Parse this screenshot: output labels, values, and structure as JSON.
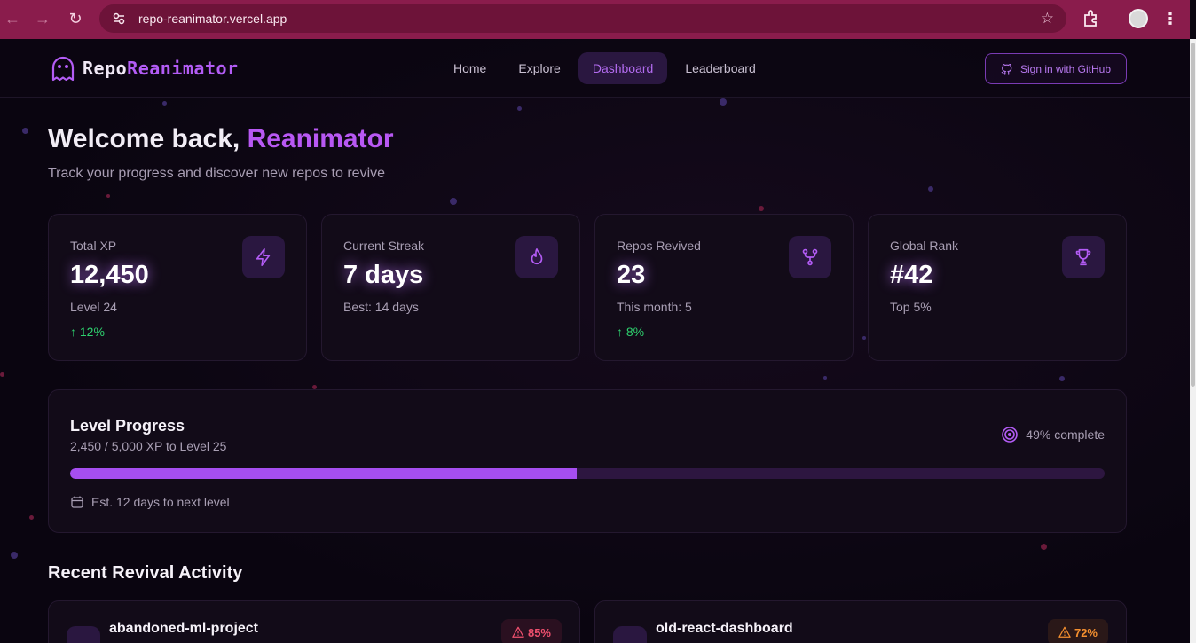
{
  "browser": {
    "url": "repo-reanimator.vercel.app"
  },
  "nav": {
    "brand_part1": "Repo",
    "brand_part2": "Reanimator",
    "links": [
      {
        "label": "Home"
      },
      {
        "label": "Explore"
      },
      {
        "label": "Dashboard"
      },
      {
        "label": "Leaderboard"
      }
    ],
    "signin_label": "Sign in with GitHub"
  },
  "hero": {
    "greeting": "Welcome back,",
    "username": "Reanimator",
    "subtitle": "Track your progress and discover new repos to revive"
  },
  "stats": [
    {
      "label": "Total XP",
      "value": "12,450",
      "sub": "Level 24",
      "trend": "↑ 12%",
      "icon": "lightning-icon"
    },
    {
      "label": "Current Streak",
      "value": "7 days",
      "sub": "Best: 14 days",
      "trend": "",
      "icon": "flame-icon"
    },
    {
      "label": "Repos Revived",
      "value": "23",
      "sub": "This month: 5",
      "trend": "↑ 8%",
      "icon": "git-fork-icon"
    },
    {
      "label": "Global Rank",
      "value": "#42",
      "sub": "Top 5%",
      "trend": "",
      "icon": "trophy-icon"
    }
  ],
  "level_progress": {
    "title": "Level Progress",
    "xp_text": "2,450 / 5,000 XP to Level 25",
    "complete_text": "49% complete",
    "fill_fraction": 0.49,
    "estimate": "Est. 12 days to next level"
  },
  "recent": {
    "title": "Recent Revival Activity",
    "items": [
      {
        "name": "abandoned-ml-project",
        "percent": "85%",
        "status_color": "#f0506e"
      },
      {
        "name": "old-react-dashboard",
        "percent": "72%",
        "status_color": "#f5902f"
      }
    ]
  },
  "colors": {
    "accent": "#b858f3",
    "chrome": "#8a1c4c",
    "positive": "#2ed06e"
  }
}
